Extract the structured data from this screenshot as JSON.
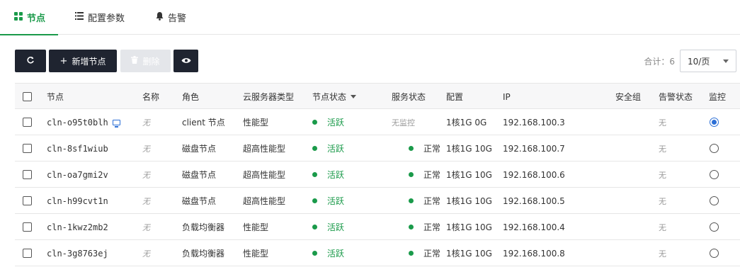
{
  "tabs": [
    {
      "label": "节点",
      "icon": "grid-icon",
      "active": true
    },
    {
      "label": "配置参数",
      "icon": "list-icon",
      "active": false
    },
    {
      "label": "告警",
      "icon": "bell-icon",
      "active": false
    }
  ],
  "toolbar": {
    "add_label": "新增节点",
    "delete_label": "删除"
  },
  "pagination": {
    "total": "合计：6",
    "page_size": "10/页"
  },
  "table": {
    "headers": {
      "node": "节点",
      "name": "名称",
      "role": "角色",
      "type": "云服务器类型",
      "node_status": "节点状态",
      "service_status": "服务状态",
      "config": "配置",
      "ip": "IP",
      "security_group": "安全组",
      "alarm_status": "告警状态",
      "monitor": "监控"
    },
    "rows": [
      {
        "node": "cln-o95t0blh",
        "name": "无",
        "role": "client 节点",
        "type": "性能型",
        "node_status": "活跃",
        "service_status": "无监控",
        "config": "1核1G 0G",
        "ip": "192.168.100.3",
        "security_group": "",
        "alarm_status": "无",
        "monitor_selected": true
      },
      {
        "node": "cln-8sf1wiub",
        "name": "无",
        "role": "磁盘节点",
        "type": "超高性能型",
        "node_status": "活跃",
        "service_status": "正常",
        "config": "1核1G 10G",
        "ip": "192.168.100.7",
        "security_group": "",
        "alarm_status": "无",
        "monitor_selected": false
      },
      {
        "node": "cln-oa7gmi2v",
        "name": "无",
        "role": "磁盘节点",
        "type": "超高性能型",
        "node_status": "活跃",
        "service_status": "正常",
        "config": "1核1G 10G",
        "ip": "192.168.100.6",
        "security_group": "",
        "alarm_status": "无",
        "monitor_selected": false
      },
      {
        "node": "cln-h99cvt1n",
        "name": "无",
        "role": "磁盘节点",
        "type": "超高性能型",
        "node_status": "活跃",
        "service_status": "正常",
        "config": "1核1G 10G",
        "ip": "192.168.100.5",
        "security_group": "",
        "alarm_status": "无",
        "monitor_selected": false
      },
      {
        "node": "cln-1kwz2mb2",
        "name": "无",
        "role": "负载均衡器",
        "type": "性能型",
        "node_status": "活跃",
        "service_status": "正常",
        "config": "1核1G 10G",
        "ip": "192.168.100.4",
        "security_group": "",
        "alarm_status": "无",
        "monitor_selected": false
      },
      {
        "node": "cln-3g8763ej",
        "name": "无",
        "role": "负载均衡器",
        "type": "性能型",
        "node_status": "活跃",
        "service_status": "正常",
        "config": "1核1G 10G",
        "ip": "192.168.100.8",
        "security_group": "",
        "alarm_status": "无",
        "monitor_selected": false
      }
    ]
  },
  "colors": {
    "accent": "#1a9a4a",
    "toolbar_button": "#1f2430",
    "selected_radio": "#2c6fd6"
  }
}
